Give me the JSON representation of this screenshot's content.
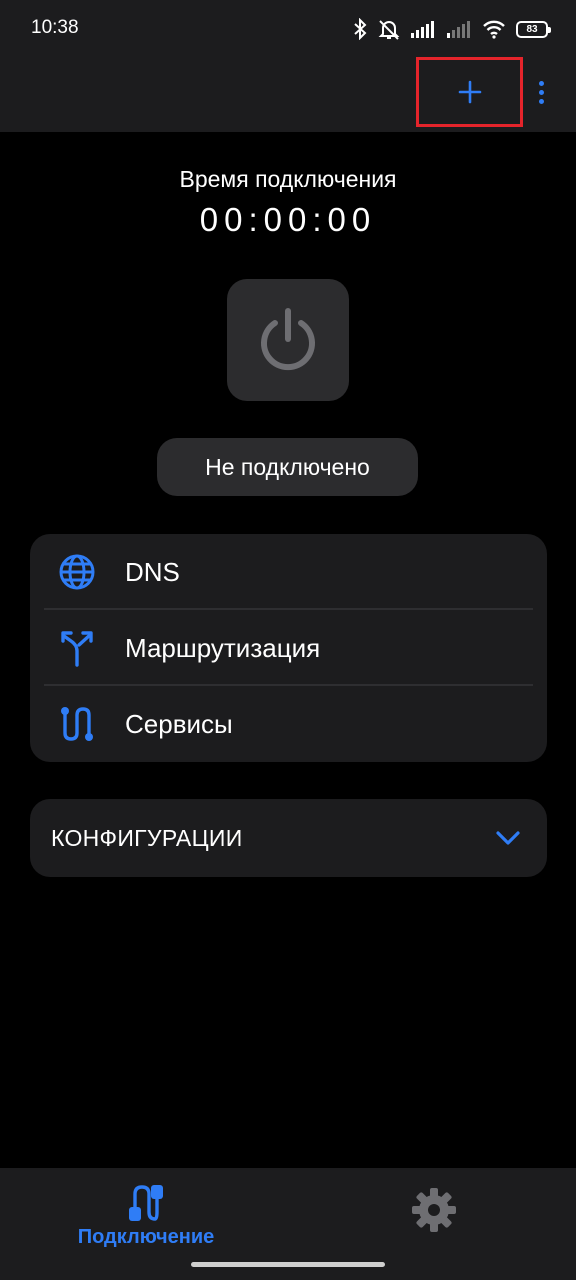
{
  "status_bar": {
    "time": "10:38",
    "battery": "83",
    "icons": [
      "bluetooth-icon",
      "bell-off-icon",
      "signal-icon",
      "signal-icon",
      "wifi-icon",
      "battery-icon"
    ]
  },
  "toolbar": {
    "add_icon": "plus-icon",
    "menu_icon": "more-vertical-icon"
  },
  "connection": {
    "time_label": "Время подключения",
    "timer": "00:00:00",
    "power_icon": "power-icon",
    "status": "Не подключено"
  },
  "menu": {
    "items": [
      {
        "label": "DNS",
        "icon": "globe-icon"
      },
      {
        "label": "Маршрутизация",
        "icon": "routing-icon"
      },
      {
        "label": "Сервисы",
        "icon": "services-icon"
      }
    ]
  },
  "configs": {
    "label": "КОНФИГУРАЦИИ",
    "icon": "chevron-down-icon"
  },
  "bottom_nav": {
    "connection_label": "Подключение",
    "connection_icon": "connection-icon",
    "settings_icon": "gear-icon"
  },
  "colors": {
    "accent": "#2f7df6",
    "background": "#000000",
    "surface": "#1c1c1e",
    "button": "#2c2c2e",
    "highlight_box": "#e5242b"
  }
}
